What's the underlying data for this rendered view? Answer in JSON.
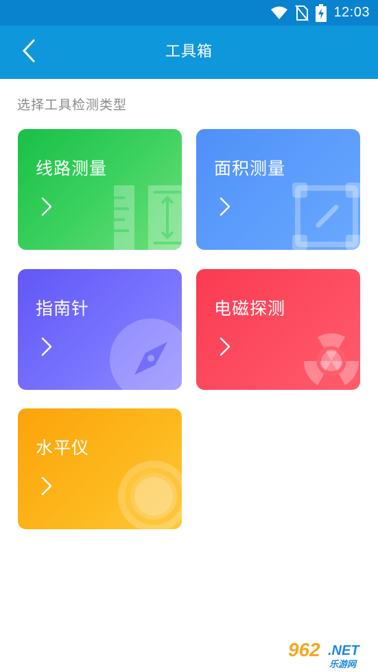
{
  "status_bar": {
    "time": "12:03",
    "icons": [
      "wifi-icon",
      "no-sim-icon",
      "battery-charging-icon"
    ]
  },
  "app_bar": {
    "title": "工具箱",
    "back_icon": "chevron-left-icon"
  },
  "section_label": "选择工具检测类型",
  "tools": [
    {
      "title": "线路测量",
      "icon": "ruler-icon",
      "colors": [
        "#18c046",
        "#6ee07a"
      ]
    },
    {
      "title": "面积测量",
      "icon": "area-frame-icon",
      "colors": [
        "#4e90f9",
        "#6aa9ff"
      ]
    },
    {
      "title": "指南针",
      "icon": "compass-icon",
      "colors": [
        "#6157f7",
        "#9089ff"
      ]
    },
    {
      "title": "电磁探测",
      "icon": "radiation-icon",
      "colors": [
        "#fb3a52",
        "#ff5d6c"
      ]
    },
    {
      "title": "水平仪",
      "icon": "level-bubble-icon",
      "colors": [
        "#fca30a",
        "#fdc83a"
      ]
    }
  ],
  "watermark": {
    "main": "962.NET",
    "sub": "乐游网"
  }
}
